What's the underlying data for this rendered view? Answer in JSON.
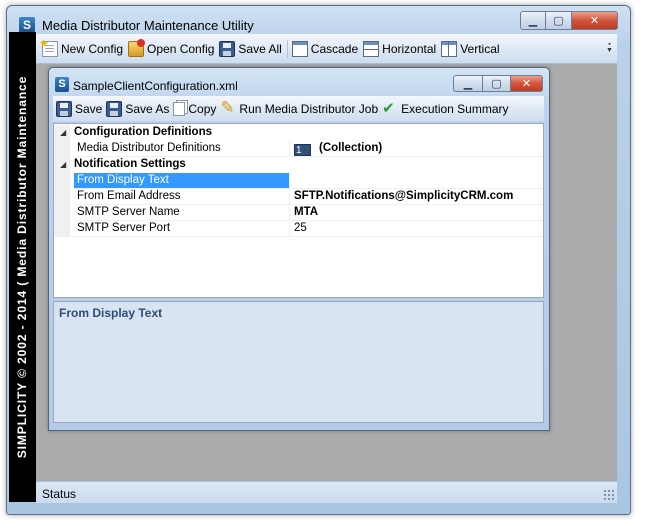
{
  "app": {
    "title": "Media Distributor Maintenance Utility",
    "icon_letter": "S",
    "banner": "SIMPLICITY © 2002 - 2014 ( Media Distributor Maintenance"
  },
  "main_toolbar": {
    "items": [
      {
        "label": "New Config",
        "icon": "new-doc-icon"
      },
      {
        "label": "Open Config",
        "icon": "open-folder-icon"
      },
      {
        "label": "Save All",
        "icon": "save-all-icon"
      },
      {
        "label": "Cascade",
        "icon": "cascade-icon"
      },
      {
        "label": "Horizontal",
        "icon": "tile-horizontal-icon"
      },
      {
        "label": "Vertical",
        "icon": "tile-vertical-icon"
      }
    ]
  },
  "child_window": {
    "title": "SampleClientConfiguration.xml",
    "icon_letter": "S",
    "toolbar": [
      {
        "label": "Save",
        "icon": "save-icon"
      },
      {
        "label": "Save As",
        "icon": "save-as-icon"
      },
      {
        "label": "Copy",
        "icon": "copy-icon"
      },
      {
        "label": "Run Media Distributor Job",
        "icon": "run-pencil-icon"
      },
      {
        "label": "Execution Summary",
        "icon": "checkmark-icon"
      }
    ]
  },
  "property_grid": {
    "categories": [
      {
        "label": "Configuration Definitions",
        "properties": [
          {
            "name": "Media Distributor Definitions",
            "count": "1",
            "value": "(Collection)"
          }
        ]
      },
      {
        "label": "Notification Settings",
        "properties": [
          {
            "name": "From Display Text",
            "value": ""
          },
          {
            "name": "From Email Address",
            "value": "SFTP.Notifications@SimplicityCRM.com"
          },
          {
            "name": "SMTP Server Name",
            "value": "MTA"
          },
          {
            "name": "SMTP Server Port",
            "value": "25"
          }
        ]
      }
    ],
    "selected_property": "From Display Text"
  },
  "help_pane": {
    "title": "From Display Text"
  },
  "status_bar": {
    "text": "Status"
  },
  "colors": {
    "selection": "#3399ff",
    "help_title": "#2f4e76",
    "mdi_background": "#ababab"
  }
}
